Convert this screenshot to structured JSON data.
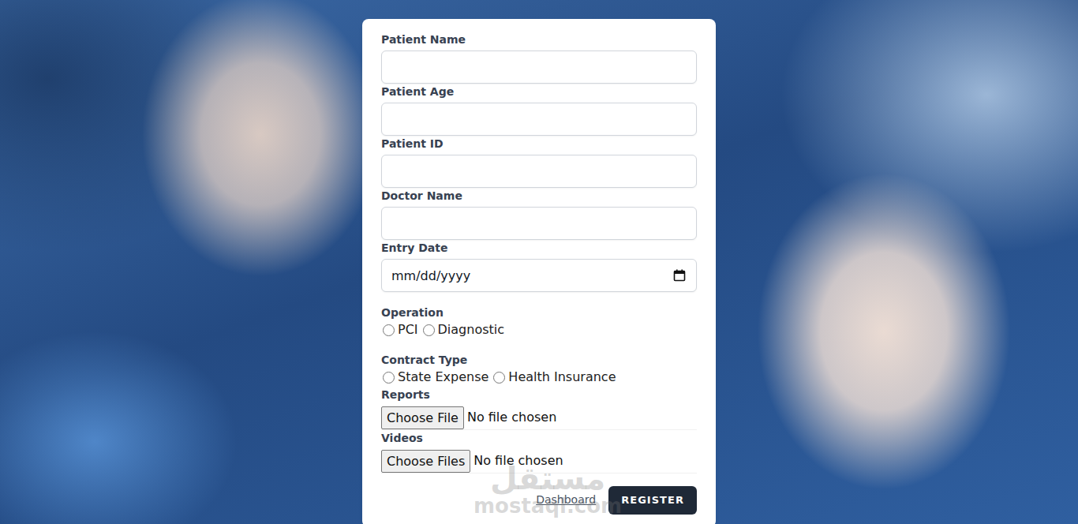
{
  "form": {
    "fields": [
      {
        "label": "Patient Name"
      },
      {
        "label": "Patient Age"
      },
      {
        "label": "Patient ID"
      },
      {
        "label": "Doctor Name"
      }
    ],
    "entry_date": {
      "label": "Entry Date",
      "placeholder": "mm/dd/yyyy"
    },
    "operation": {
      "label": "Operation",
      "options": [
        {
          "label": "PCI",
          "selected": false
        },
        {
          "label": "Diagnostic",
          "selected": false
        }
      ]
    },
    "contract_type": {
      "label": "Contract Type",
      "options": [
        {
          "label": "State Expense",
          "selected": false
        },
        {
          "label": "Health Insurance",
          "selected": false
        }
      ]
    },
    "reports": {
      "label": "Reports",
      "button": "Choose File",
      "status": "No file chosen"
    },
    "videos": {
      "label": "Videos",
      "button": "Choose Files",
      "status": "No file chosen"
    },
    "dashboard_link": "Dashboard",
    "submit": "REGISTER"
  },
  "watermark": {
    "arabic": "مستقل",
    "latin": "mostaql.com"
  }
}
